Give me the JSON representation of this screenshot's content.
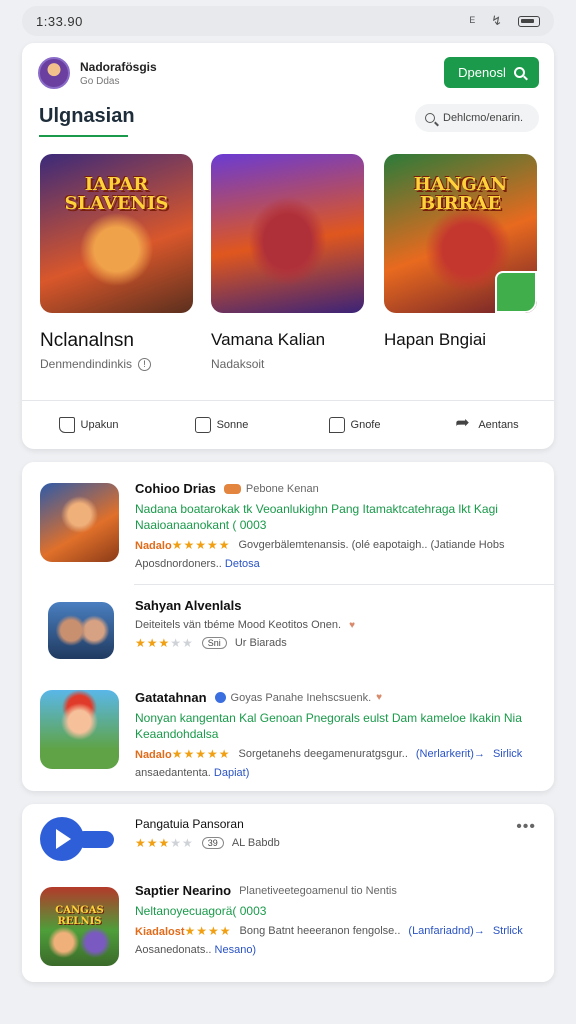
{
  "status": {
    "time": "1:33.90",
    "icon_a": "silent-icon",
    "icon_b": "wifi-icon",
    "icon_c": "battery-icon"
  },
  "header": {
    "user_name": "Nadorafösgis",
    "user_sub": "Go Ddas",
    "open_button": "Dpenosl"
  },
  "section": {
    "title": "Ulgnasian",
    "search_placeholder": "Dehlcmo/enarin."
  },
  "featured": [
    {
      "art_title": "IAPAR SLAVENIS",
      "name": "Nclanalnsn",
      "sub": "Denmendindinkis"
    },
    {
      "art_title": "",
      "name": "Vamana Kalian",
      "sub": "Nadaksoit"
    },
    {
      "art_title": "HANGAN BIRRAE",
      "name": "Hapan Bngiai",
      "sub": ""
    }
  ],
  "actions": [
    {
      "label": "Upakun",
      "icon": "thumbs-up-icon"
    },
    {
      "label": "Sonne",
      "icon": "list-icon"
    },
    {
      "label": "Gnofe",
      "icon": "comment-icon"
    },
    {
      "label": "Aentans",
      "icon": "share-icon"
    }
  ],
  "list": [
    {
      "title": "Cohioo Drias",
      "meta": "Pebone Kenan",
      "desc": "Nadana boatarokak tk Veoanlukighn Pang Itamaktcatehraga lkt Kagi Naaioanaanokant ( 0003",
      "rating_label": "Nadalo",
      "stars": 5,
      "stars_note": "Govgerbälemtenansis. (olé eapotaigh.. (Jatiande Hobs",
      "foot": "Aposdnordoners..",
      "foot_link": "Detosa"
    },
    {
      "title": "Sahyan Alvenlals",
      "meta": "",
      "desc_gray": "Deiteitels vän tbéme Mood Keotitos Onen.",
      "stars": 3,
      "stars_note": "Ur Biarads",
      "pill": "Sni",
      "foot": ""
    },
    {
      "title": "Gatatahnan",
      "meta": "Goyas Panahe Inehscsuenk.",
      "desc": "Nonyan kangentan Kal Genoan Pnegorals eulst Dam kameloe Ikakin Nia Keaandohdalsa",
      "rating_label": "Nadalo",
      "stars": 5,
      "stars_note": "Sorgetanehs deegamenuratgsgur..",
      "stars_link": "(Nerlarkerit)→",
      "stars_link2": "Sirlick",
      "foot": "ansaedantenta.",
      "foot_link": "Dapiat)"
    },
    {
      "title": "Pangatuia Pansoran",
      "stars": 3,
      "pill": "39",
      "stars_note": "AL Babdb"
    },
    {
      "title": "Saptier Nearino",
      "meta": "Planetiveetegoamenul tio Nentis",
      "desc": "Neltanoyecuagorä( 0003",
      "rating_label": "Kiadalost",
      "stars": 4,
      "stars_note": "Bong Batnt heeeranon fengolse..",
      "stars_link": "(Lanfariadnd)→",
      "stars_link2": "Strlick",
      "foot": "Aosanedonats..",
      "foot_link": "Nesano)",
      "art_title": "CANGAS RELNIS"
    }
  ],
  "colors": {
    "accent": "#1a9a4a",
    "link": "#2a53c4",
    "star": "#f0a012",
    "rating": "#e26b1a",
    "play": "#2f5fd8"
  }
}
